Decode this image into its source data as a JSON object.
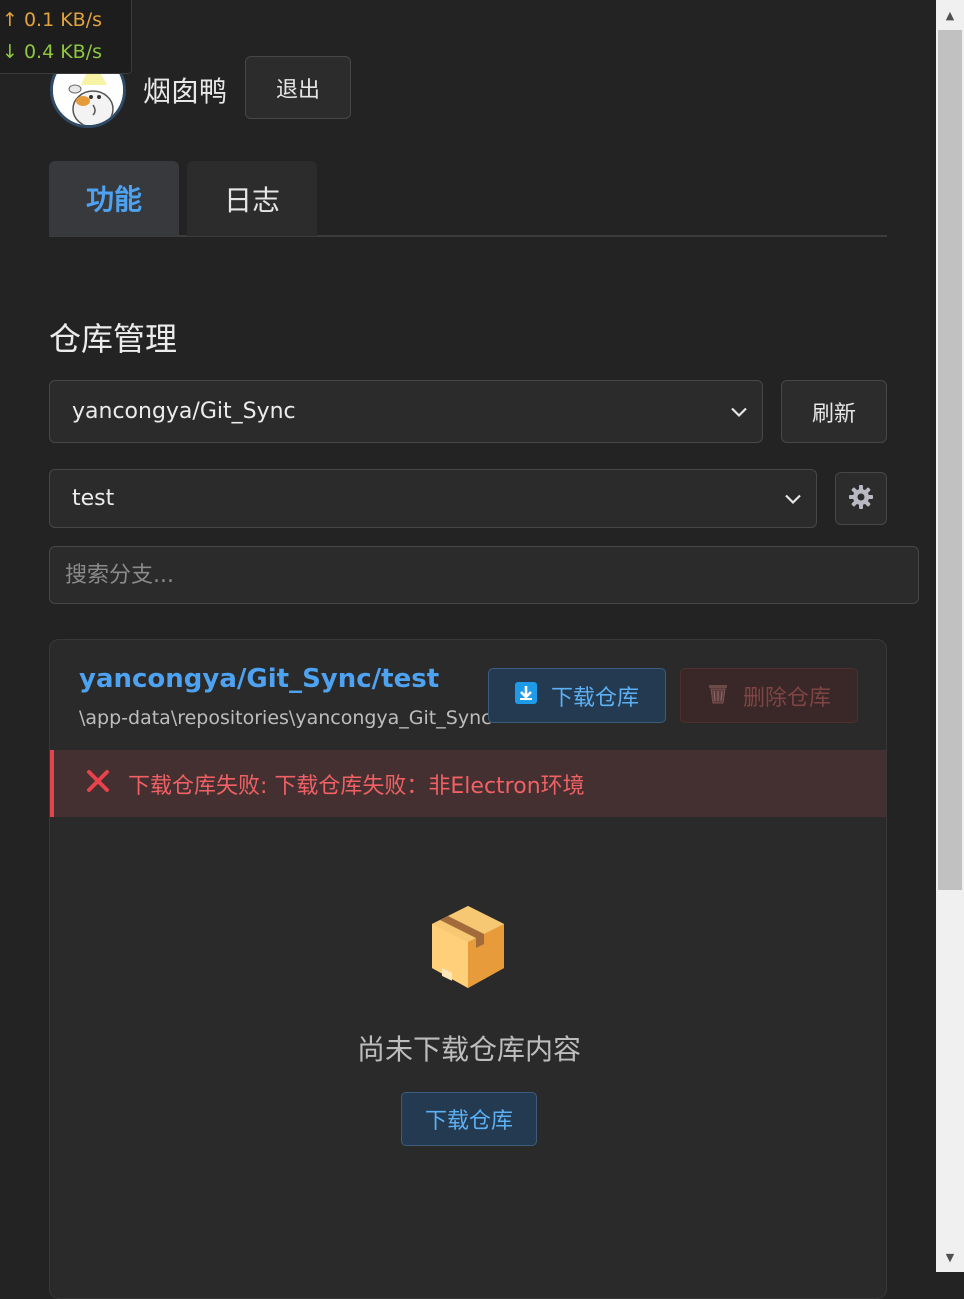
{
  "netspeed": {
    "up": "↑ 0.1 KB/s",
    "down": "↓ 0.4 KB/s"
  },
  "header": {
    "username": "烟囱鸭",
    "logout_label": "退出"
  },
  "tabs": [
    {
      "label": "功能",
      "active": true
    },
    {
      "label": "日志",
      "active": false
    }
  ],
  "repo_manager": {
    "title": "仓库管理",
    "repo_select_value": "yancongya/Git_Sync",
    "refresh_label": "刷新",
    "branch_select_value": "test",
    "branch_search_placeholder": "搜索分支..."
  },
  "repo_card": {
    "name": "yancongya/Git_Sync/test",
    "path": "\\app-data\\repositories\\yancongya_Git_Sync",
    "download_label": "下载仓库",
    "delete_label": "删除仓库",
    "error_message": "下载仓库失败: 下载仓库失败：非Electron环境",
    "empty_message": "尚未下载仓库内容",
    "empty_download_label": "下载仓库"
  },
  "colors": {
    "accent": "#4da2f1",
    "error": "#f06065",
    "background": "#232323"
  }
}
